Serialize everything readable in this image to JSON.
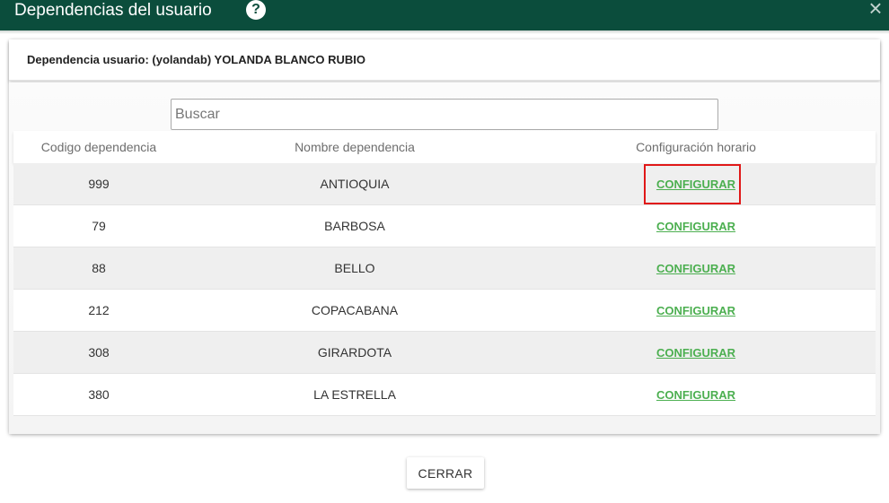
{
  "dialog": {
    "title": "Dependencias del usuario",
    "help_icon": "?",
    "close_icon": "×"
  },
  "header": {
    "text": "Dependencia usuario: (yolandab) YOLANDA BLANCO RUBIO"
  },
  "search": {
    "placeholder": "Buscar"
  },
  "table": {
    "columns": [
      "Codigo dependencia",
      "Nombre dependencia",
      "Configuración horario"
    ],
    "rows": [
      {
        "code": "999",
        "name": "ANTIOQUIA",
        "action": "CONFIGURAR"
      },
      {
        "code": "79",
        "name": "BARBOSA",
        "action": "CONFIGURAR"
      },
      {
        "code": "88",
        "name": "BELLO",
        "action": "CONFIGURAR"
      },
      {
        "code": "212",
        "name": "COPACABANA",
        "action": "CONFIGURAR"
      },
      {
        "code": "308",
        "name": "GIRARDOTA",
        "action": "CONFIGURAR"
      },
      {
        "code": "380",
        "name": "LA ESTRELLA",
        "action": "CONFIGURAR"
      }
    ]
  },
  "footer": {
    "close_label": "CERRAR"
  },
  "colors": {
    "titlebar": "#0b4d3c",
    "link": "#4caf50",
    "highlight": "#e01818"
  }
}
